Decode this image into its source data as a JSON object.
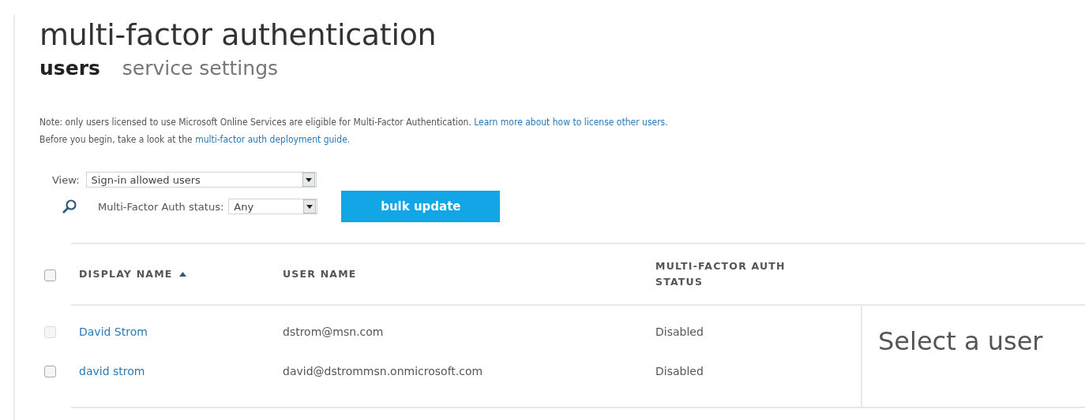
{
  "title": "multi-factor authentication",
  "tabs": [
    {
      "label": "users",
      "selected": true
    },
    {
      "label": "service settings",
      "selected": false
    }
  ],
  "note": {
    "lines": [
      {
        "text": "Note: only users licensed to use Microsoft Online Services are eligible for Multi-Factor Authentication.",
        "link": "Learn more about how to license other users."
      },
      {
        "text": "Before you begin, take a look at the",
        "link": "multi-factor auth deployment guide."
      }
    ]
  },
  "view": {
    "label": "View:",
    "value": "Sign-in allowed users"
  },
  "filter": {
    "label": "Multi-Factor Auth status:",
    "value": "Any"
  },
  "bulk_button": "bulk update",
  "table": {
    "select_all": {
      "checked": false
    },
    "columns": [
      {
        "label": "DISPLAY NAME",
        "sorted": true
      },
      {
        "label": "USER NAME",
        "sorted": false
      },
      {
        "label": "MULTI-FACTOR AUTH STATUS",
        "sorted": false
      }
    ],
    "rows": [
      {
        "checked": false,
        "disabled": true,
        "display_name": "David Strom",
        "user_name": "dstrom@msn.com",
        "status": "Disabled"
      },
      {
        "checked": false,
        "disabled": false,
        "display_name": "david strom",
        "user_name": "david@dstrommsn.onmicrosoft.com",
        "status": "Disabled"
      }
    ]
  },
  "detail_panel": {
    "heading": "Select a user"
  }
}
